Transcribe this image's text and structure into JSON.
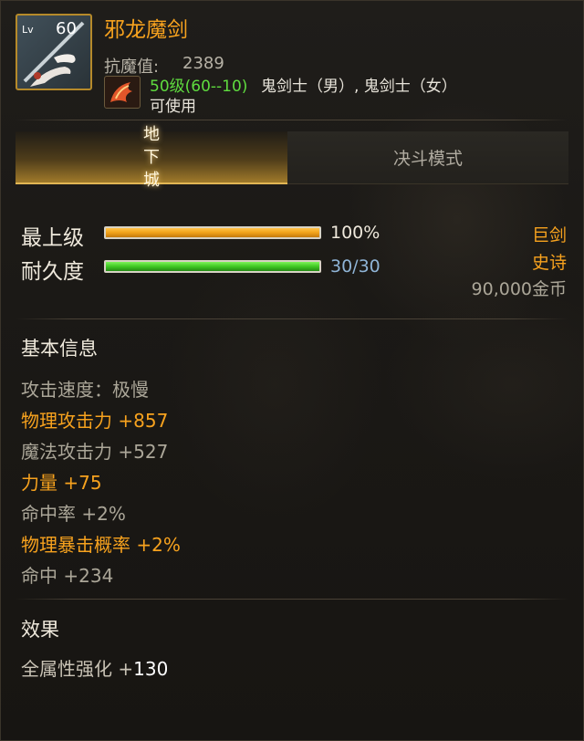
{
  "item": {
    "lv_label": "Lv",
    "level": "60",
    "name": "邪龙魔剑",
    "resist_label": "抗魔值:",
    "resist_value": "2389",
    "req_level": "50级(60--10)",
    "req_classes": "鬼剑士（男）, 鬼剑士（女）",
    "usable": "可使用",
    "icon": "sword-icon",
    "class_icon": "ghost-swordsman-class-icon"
  },
  "tabs": [
    {
      "label": "地下城",
      "active": true
    },
    {
      "label": "决斗模式",
      "active": false
    }
  ],
  "bars": {
    "upgrade": {
      "label": "最上级",
      "value_text": "100%",
      "fraction": 1.0
    },
    "durability": {
      "label": "耐久度",
      "value_text": "30/30",
      "fraction": 1.0
    }
  },
  "right_info": {
    "weapon_type": "巨剑",
    "rarity": "史诗",
    "price": "90,000金币"
  },
  "basic_info": {
    "title": "基本信息",
    "attrs": [
      {
        "text": "攻击速度：极慢",
        "style": "gray"
      },
      {
        "text": "物理攻击力 +857",
        "style": "orange"
      },
      {
        "text": "魔法攻击力 +527",
        "style": "gray"
      },
      {
        "text": "力量 +75",
        "style": "orange"
      },
      {
        "text": "命中率 +2%",
        "style": "gray"
      },
      {
        "text": "物理暴击概率 +2%",
        "style": "orange"
      },
      {
        "text": "命中 +234",
        "style": "gray"
      }
    ]
  },
  "effects": {
    "title": "效果",
    "line_label": "全属性强化 +",
    "line_value": "130"
  },
  "colors": {
    "title": "#f7a21e",
    "requirement": "#5fdc3f",
    "upgrade_bar": "#f0a21a",
    "durability_bar": "#3fc824",
    "durability_text": "#8fb4d6"
  }
}
